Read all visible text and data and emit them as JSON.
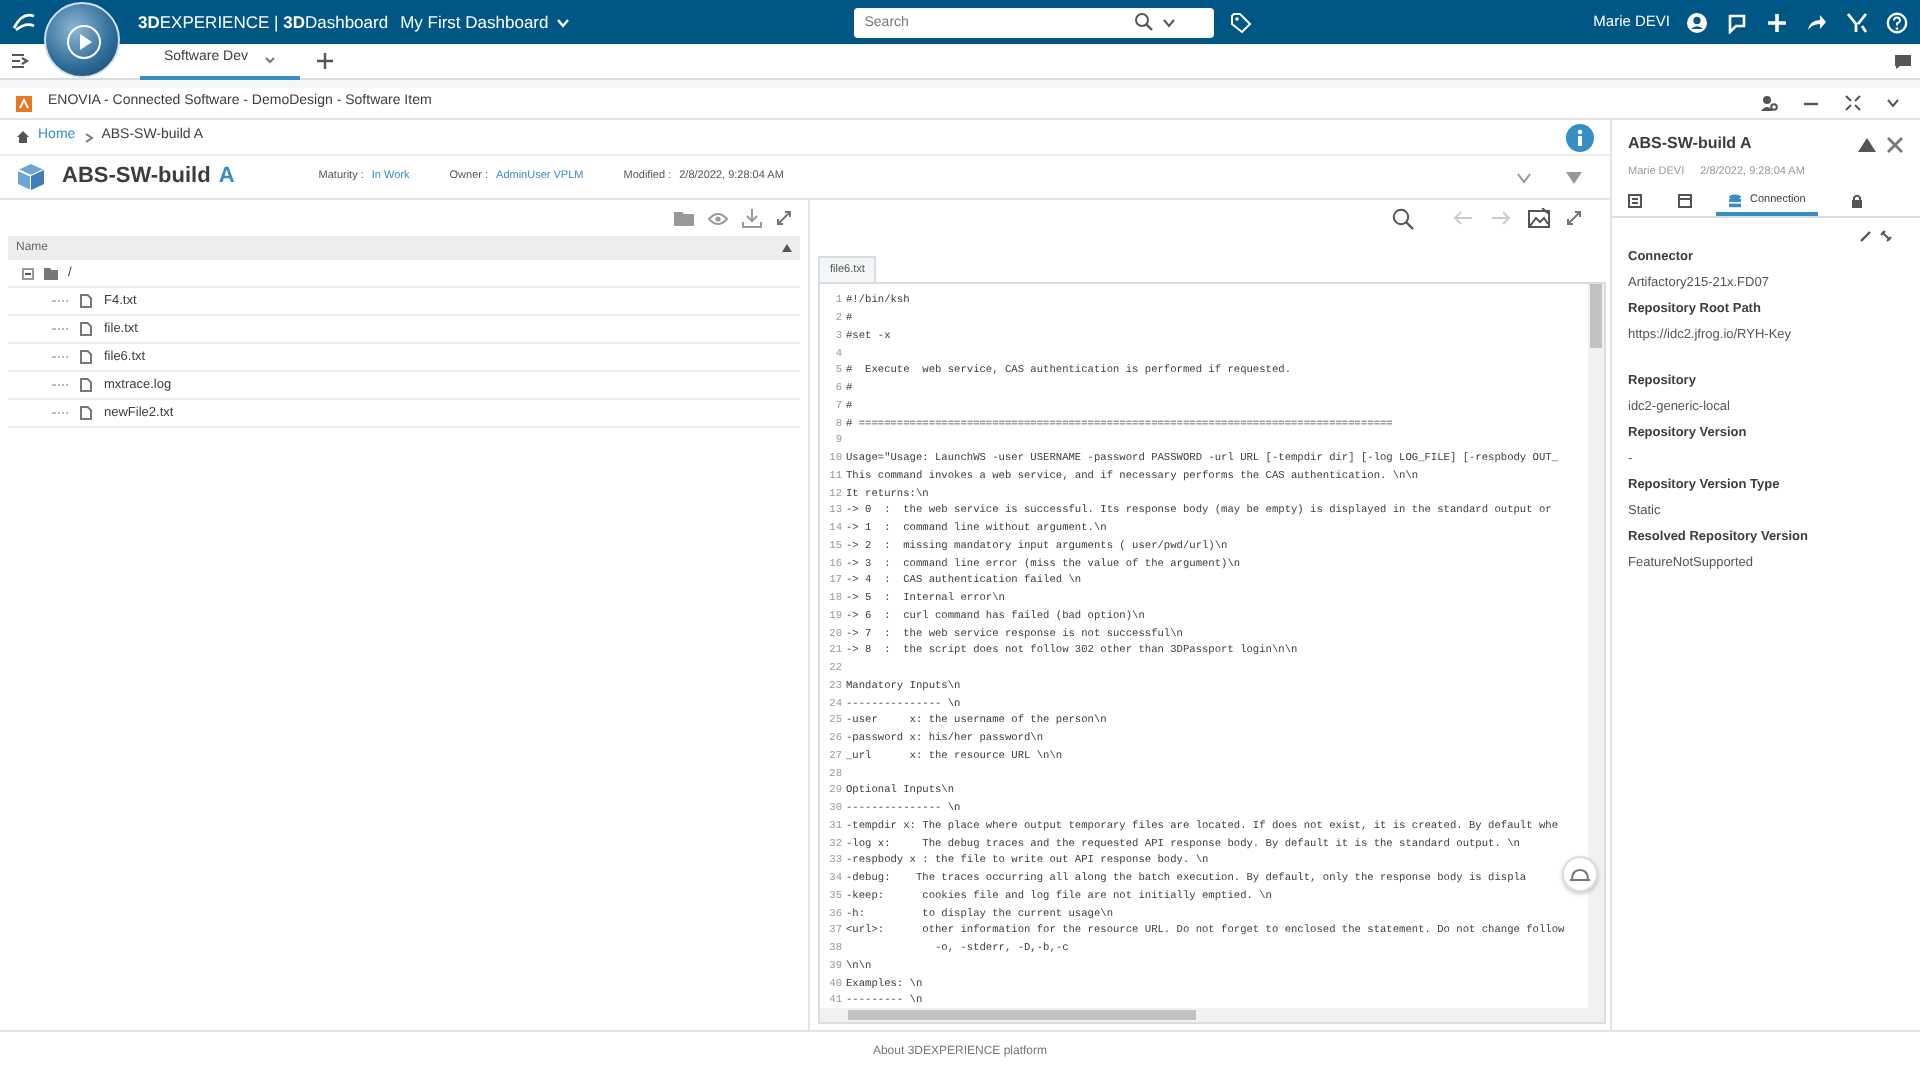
{
  "topbar": {
    "brand": "**3D**EXPERIENCE | **3D**Dashboard",
    "dashboard": "My First Dashboard",
    "search": {
      "placeholder": "Search"
    },
    "user": "Marie DEVI"
  },
  "tabs": [
    {
      "label": "Software Dev",
      "selected": true
    }
  ],
  "app_bar": {
    "title": "ENOVIA - Connected Software - DemoDesign - Software Item"
  },
  "breadcrumb": [
    {
      "label": "Home",
      "kind": "home"
    },
    {
      "label": "ABS-SW-build A",
      "kind": "current"
    }
  ],
  "object": {
    "name": "ABS-SW-build",
    "revision": "A",
    "maturity_label": "Maturity :",
    "maturity": "In Work",
    "owner_label": "Owner :",
    "owner": "AdminUser VPLM",
    "modified_label": "Modified :",
    "modified": "2/8/2022, 9:28:04 AM"
  },
  "tree": {
    "column": "Name",
    "root": {
      "label": "/",
      "expanded": true,
      "children": [
        {
          "label": "F4.txt"
        },
        {
          "label": "file.txt"
        },
        {
          "label": "file6.txt"
        },
        {
          "label": "mxtrace.log"
        },
        {
          "label": "newFile2.txt"
        }
      ]
    }
  },
  "viewer": {
    "tabs": [
      {
        "label": "file6.txt",
        "selected": true
      }
    ],
    "lines": [
      {
        "n": "1",
        "text": "#!/bin/ksh"
      },
      {
        "n": "2",
        "text": "#"
      },
      {
        "n": "3",
        "text": "#set -x"
      },
      {
        "n": "4"
      },
      {
        "n": "5",
        "text": "#  Execute  web service, CAS authentication is performed if requested."
      },
      {
        "n": "6",
        "text": "#"
      },
      {
        "n": "7",
        "text": "#"
      },
      {
        "n": "8",
        "text": "# ===================================================================================="
      },
      {
        "n": "9"
      },
      {
        "n": "10",
        "text": "Usage=\"Usage: LaunchWS -user USERNAME -password PASSWORD -url URL [-tempdir dir] [-log LOG_FILE] [-respbody OUT_"
      },
      {
        "n": "11",
        "text": "This command invokes a web service, and if necessary performs the CAS authentication. \\n\\n"
      },
      {
        "n": "12",
        "text": "It returns:\\n"
      },
      {
        "n": "13",
        "text": "-> 0  :  the web service is successful. Its response body (may be empty) is displayed in the standard output or"
      },
      {
        "n": "14",
        "text": "-> 1  :  command line without argument.\\n"
      },
      {
        "n": "15",
        "text": "-> 2  :  missing mandatory input arguments ( user/pwd/url)\\n"
      },
      {
        "n": "16",
        "text": "-> 3  :  command line error (miss the value of the argument)\\n"
      },
      {
        "n": "17",
        "text": "-> 4  :  CAS authentication failed \\n"
      },
      {
        "n": "18",
        "text": "-> 5  :  Internal error\\n"
      },
      {
        "n": "19",
        "text": "-> 6  :  curl command has failed (bad option)\\n"
      },
      {
        "n": "20",
        "text": "-> 7  :  the web service response is not successful\\n"
      },
      {
        "n": "21",
        "text": "-> 8  :  the script does not follow 302 other than 3DPassport login\\n\\n"
      },
      {
        "n": "22"
      },
      {
        "n": "23",
        "text": "Mandatory Inputs\\n"
      },
      {
        "n": "24",
        "text": "--------------- \\n"
      },
      {
        "n": "25",
        "text": "-user     x: the username of the person\\n"
      },
      {
        "n": "26",
        "text": "-password x: his/her password\\n"
      },
      {
        "n": "27",
        "text": "_url      x: the resource URL \\n\\n"
      },
      {
        "n": "28"
      },
      {
        "n": "29",
        "text": "Optional Inputs\\n"
      },
      {
        "n": "30",
        "text": "--------------- \\n"
      },
      {
        "n": "31",
        "text": "-tempdir x: The place where output temporary files are located. If does not exist, it is created. By default whe"
      },
      {
        "n": "32",
        "text": "-log x:     The debug traces and the requested API response body. By default it is the standard output. \\n"
      },
      {
        "n": "33",
        "text": "-respbody x : the file to write out API response body. \\n"
      },
      {
        "n": "34",
        "text": "-debug:    The traces occurring all along the batch execution. By default, only the response body is displa"
      },
      {
        "n": "35",
        "text": "-keep:      cookies file and log file are not initially emptied. \\n"
      },
      {
        "n": "36",
        "text": "-h:         to display the current usage\\n"
      },
      {
        "n": "37",
        "text": "<url>:      other information for the resource URL. Do not forget to enclosed the statement. Do not change follow"
      },
      {
        "n": "38",
        "text": "              -o, -stderr, -D,-b,-c"
      },
      {
        "n": "39",
        "text": "\\n\\n"
      },
      {
        "n": "40",
        "text": "Examples: \\n"
      },
      {
        "n": "41",
        "text": "--------- \\n"
      }
    ]
  },
  "panel": {
    "title": "ABS-SW-build A",
    "user": "Marie DEVI",
    "date": "2/8/2022, 9:28:04 AM",
    "tabs": [
      {
        "kind": "properties",
        "selected": false
      },
      {
        "kind": "calendar",
        "selected": false
      },
      {
        "kind": "connection",
        "label": "Connection",
        "selected": true
      },
      {
        "kind": "lock",
        "selected": false
      }
    ],
    "fields": [
      {
        "label": "Connector",
        "value": "Artifactory215-21x.FD07"
      },
      {
        "label": "Repository Root Path",
        "value": "https://idc2.jfrog.io/RYH-Key"
      },
      {
        "label": "Repository",
        "value": "idc2-generic-local"
      },
      {
        "label": "Repository Version",
        "value": "-"
      },
      {
        "label": "Repository Version Type",
        "value": "Static"
      },
      {
        "label": "Resolved Repository Version",
        "value": "FeatureNotSupported"
      }
    ]
  },
  "footer": "About 3DEXPERIENCE platform"
}
